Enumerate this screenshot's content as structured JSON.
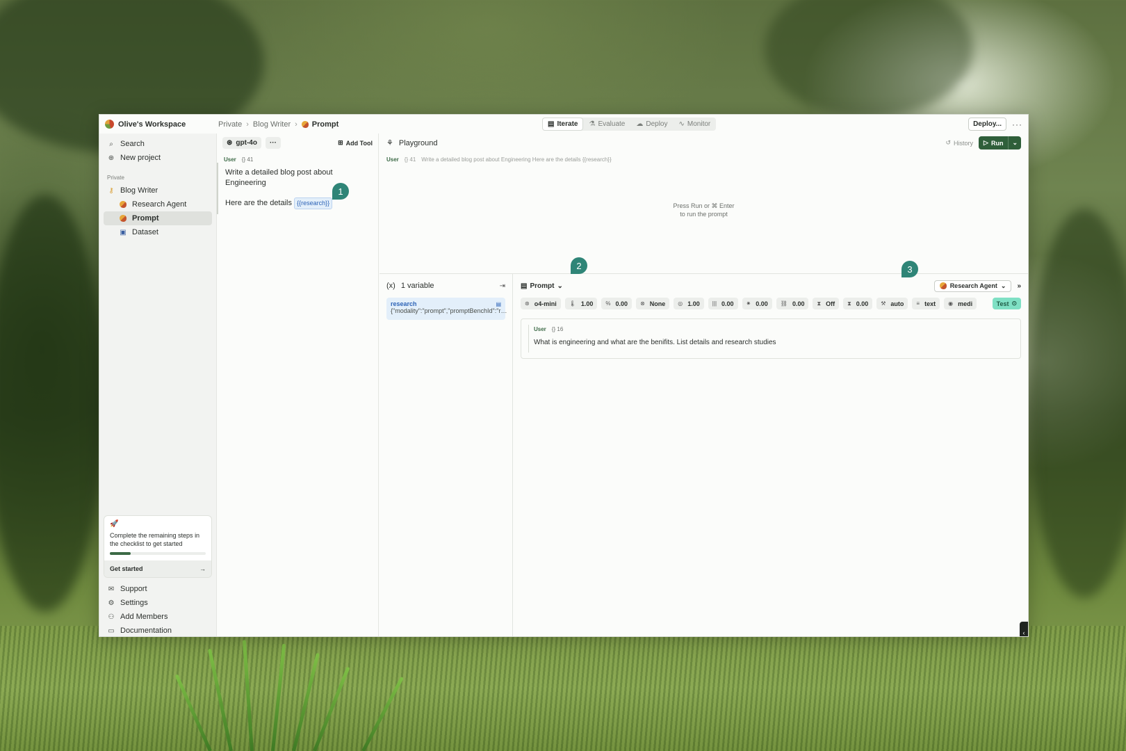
{
  "colors": {
    "accent": "#2f5f3a",
    "marker": "#2f8577",
    "variable": "#2d63b6",
    "test": "#7fe0c4"
  },
  "workspace": {
    "name": "Olive's Workspace"
  },
  "breadcrumb": {
    "items": [
      "Private",
      "Blog Writer"
    ],
    "current": "Prompt"
  },
  "modes": [
    "Iterate",
    "Evaluate",
    "Deploy",
    "Monitor"
  ],
  "top": {
    "deploy_label": "Deploy...",
    "more": "···"
  },
  "sidebar": {
    "search": "Search",
    "new_project": "New project",
    "section": "Private",
    "items": [
      {
        "label": "Blog Writer",
        "icon": "key-icon"
      },
      {
        "label": "Research Agent",
        "icon": "agent-icon"
      },
      {
        "label": "Prompt",
        "icon": "prompt-icon",
        "active": true
      },
      {
        "label": "Dataset",
        "icon": "dataset-icon"
      }
    ],
    "checklist": {
      "text": "Complete the remaining steps in the checklist to get started",
      "progress": 0.22,
      "cta": "Get started"
    },
    "footer": [
      "Support",
      "Settings",
      "Add Members",
      "Documentation"
    ]
  },
  "editor": {
    "model": "gpt-4o",
    "more": "···",
    "add_tool": "Add Tool",
    "role": "User",
    "tokens": "41",
    "line1": "Write a detailed blog post about Engineering",
    "line2": "Here are the details",
    "variable": "{{research}}"
  },
  "markers": [
    "1",
    "2",
    "3"
  ],
  "playground": {
    "title": "Playground",
    "history": "History",
    "run": "Run",
    "user_role": "User",
    "user_tokens": "41",
    "user_text": "Write a detailed blog post about Engineering Here are the details {{research}}",
    "hint_line1": "Press Run or ⌘ Enter",
    "hint_line2": "to run the prompt"
  },
  "variables": {
    "count_label": "1 variable",
    "name": "research",
    "value": "{\"modality\":\"prompt\",\"promptBenchId\":\"research\"}"
  },
  "run_pane": {
    "source": "Prompt",
    "agent": "Research Agent",
    "params": [
      "o4-mini",
      "1.00",
      "0.00",
      "None",
      "1.00",
      "0.00",
      "0.00",
      "0.00",
      "Off",
      "0.00",
      "auto",
      "text",
      "medi"
    ],
    "test": "Test",
    "message": {
      "role": "User",
      "tokens": "16",
      "text": "What is engineering and what are the benifits. List details and research studies"
    }
  }
}
